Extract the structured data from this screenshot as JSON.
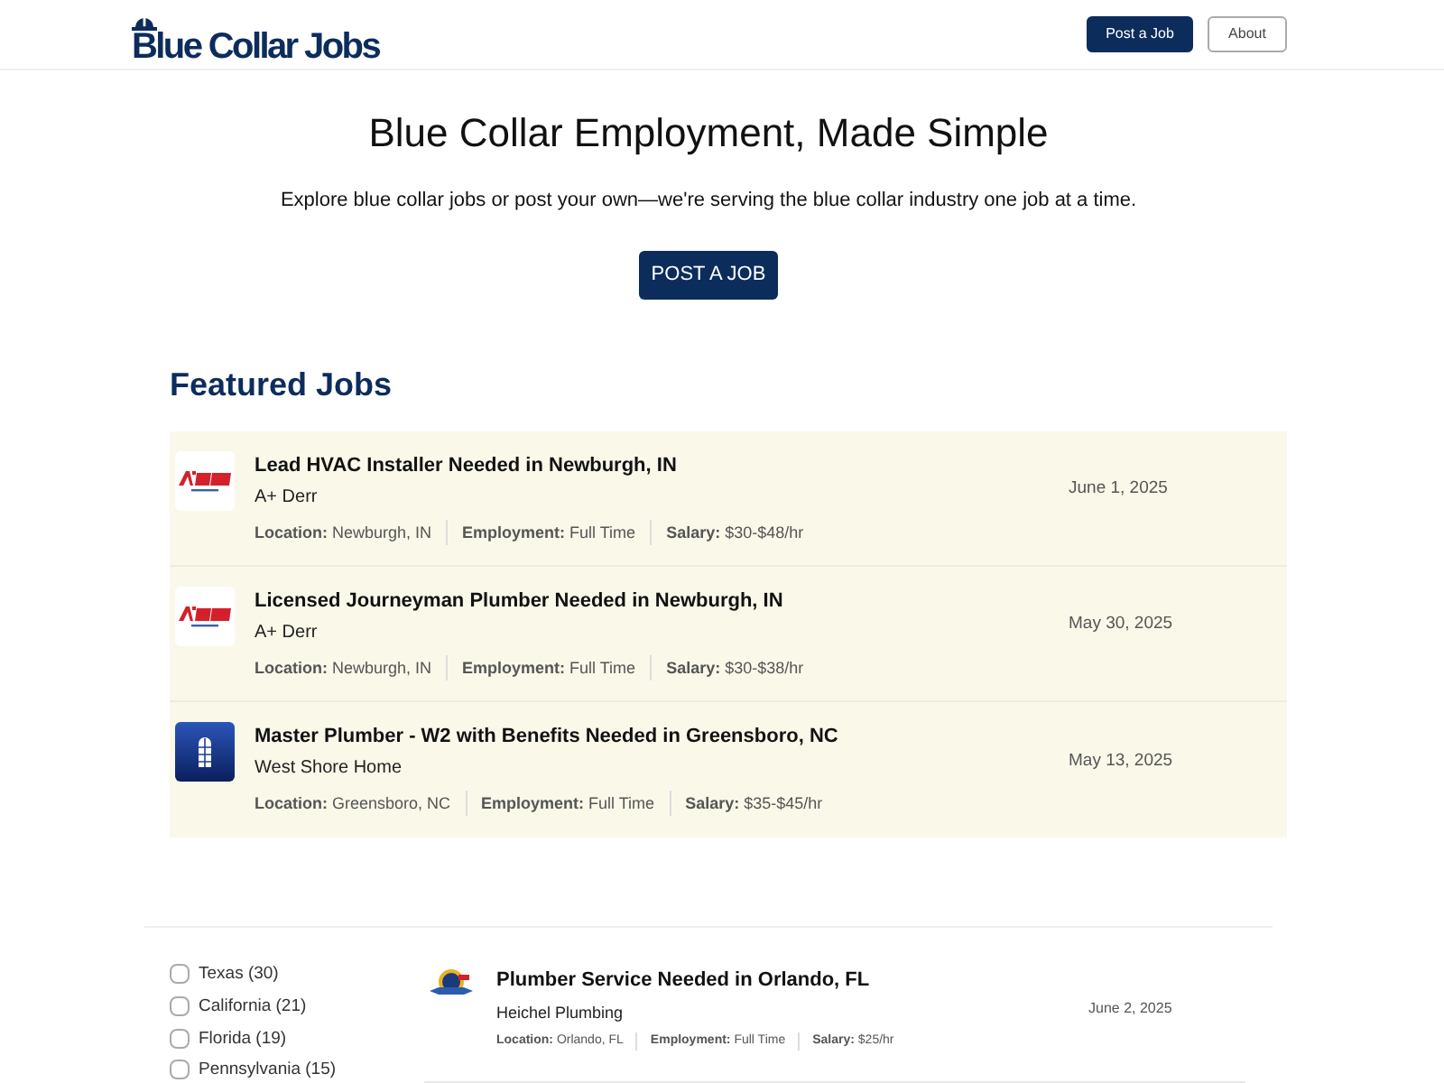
{
  "header": {
    "logo": "Blue Collar Jobs",
    "buttons": [
      {
        "label": "Post a Job",
        "kind": "primary"
      },
      {
        "label": "About",
        "kind": "outline"
      }
    ]
  },
  "hero": {
    "title": "Blue Collar Employment, Made Simple",
    "subtitle": "Explore blue collar jobs or post your own—we're serving the blue collar industry one job at a time.",
    "button": "POST A JOB"
  },
  "featured": {
    "heading": "Featured Jobs",
    "jobs": [
      {
        "kind": "wordmark",
        "title": "Lead HVAC Installer Needed in Newburgh, IN",
        "company": "A+ Derr",
        "details": [
          "**Location:** Newburgh, IN",
          "**Employment:** Full Time",
          "**Salary:** $30-$48/hr"
        ],
        "date": "June 1, 2025"
      },
      {
        "kind": "wordmark",
        "title": "Licensed Journeyman Plumber Needed in Newburgh, IN",
        "company": "A+ Derr",
        "details": [
          "**Location:** Newburgh, IN",
          "**Employment:** Full Time",
          "**Salary:** $30-$38/hr"
        ],
        "date": "May 30, 2025"
      },
      {
        "kind": "window",
        "title": "Master Plumber - W2 with Benefits Needed in Greensboro, NC",
        "company": "West Shore Home",
        "details": [
          "**Location:** Greensboro, NC",
          "**Employment:** Full Time",
          "**Salary:** $35-$45/hr"
        ],
        "date": "May 13, 2025"
      }
    ]
  },
  "filters": [
    {
      "label": "Texas (30)",
      "checked": false
    },
    {
      "label": "California (21)",
      "checked": false
    },
    {
      "label": "Florida (19)",
      "checked": false
    },
    {
      "label": "Pennsylvania (15)",
      "checked": false
    }
  ],
  "jobs": [
    {
      "kind": "emblem",
      "title": "Plumber Service Needed in Orlando, FL",
      "company": "Heichel Plumbing",
      "details": [
        "**Location:** Orlando, FL",
        "**Employment:** Full Time",
        "**Salary:** $25/hr"
      ],
      "date": "June 2, 2025"
    }
  ]
}
